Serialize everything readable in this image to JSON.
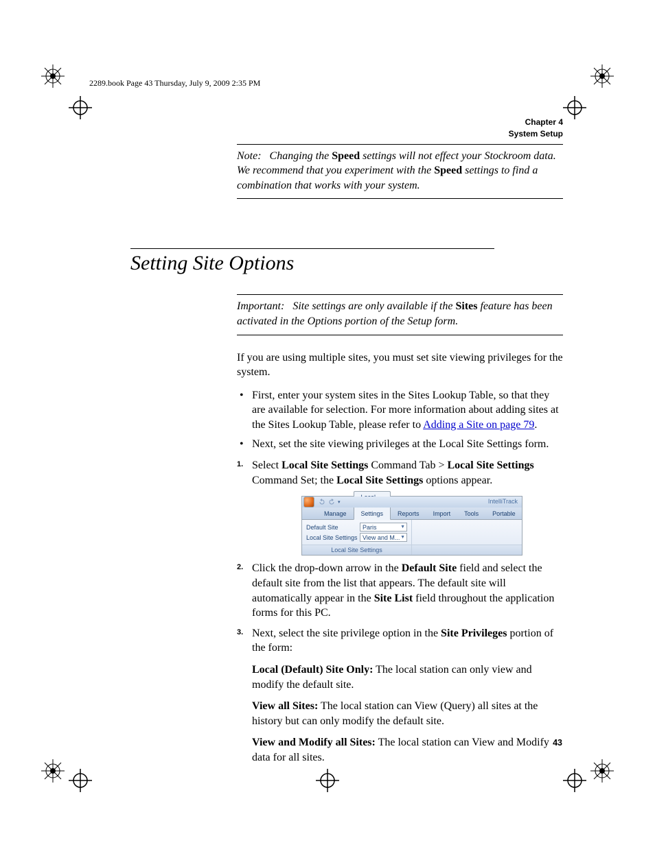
{
  "header_slug": "2289.book  Page 43  Thursday, July 9, 2009  2:35 PM",
  "running_head": {
    "line1": "Chapter 4",
    "line2": "System Setup"
  },
  "note": {
    "label": "Note:",
    "t1": "Changing the ",
    "b1": "Speed",
    "t2": " settings will not effect your Stockroom data. We recommend that you experiment with the ",
    "b2": "Speed",
    "t3": " settings to find a combination that works with your system."
  },
  "section_title": "Setting Site Options",
  "important": {
    "label": "Important:",
    "t1": "Site settings are only available if the ",
    "b1": "Sites",
    "t2": " feature has been activated in the Options portion of the Setup form."
  },
  "intro": "If you are using multiple sites, you must set site viewing privileges for the system.",
  "bullets": {
    "b1a": "First, enter your system sites in the Sites Lookup Table, so that they are available for selection. For more information about adding sites at the Sites Lookup Table, please refer to ",
    "b1link": "Adding a Site on page 79",
    "b1b": ".",
    "b2": "Next, set the site viewing privileges at the Local Site Settings form."
  },
  "steps": {
    "s1": {
      "num": "1.",
      "a": "Select ",
      "b1": "Local Site Settings",
      "b": " Command Tab > ",
      "b2": "Local Site Settings",
      "c": " Command Set; the ",
      "b3": "Local Site Settings",
      "d": " options appear."
    },
    "s2": {
      "num": "2.",
      "a": "Click the drop-down arrow in the ",
      "b1": "Default Site",
      "b": " field and select the default site from the list that appears. The default site will automatically appear in the ",
      "b2": "Site List",
      "c": " field throughout the application forms for this PC."
    },
    "s3": {
      "num": "3.",
      "a": "Next, select the site privilege option in the ",
      "b1": "Site Privileges",
      "b": " portion of the form:"
    }
  },
  "priv": {
    "p1l": "Local (Default) Site Only:",
    "p1t": " The local station can only view and modify the default site.",
    "p2l": "View all Sites:",
    "p2t": " The local station can View (Query) all sites at the history but can only modify the default site.",
    "p3l": "View and Modify all Sites:",
    "p3t": " The local station can View and Modify data for all sites."
  },
  "ribbon": {
    "app_title": "IntelliTrack",
    "tabs": [
      "Manage",
      "Local Site Settings",
      "Reports",
      "Import",
      "Tools",
      "Portable"
    ],
    "active_tab_index": 1,
    "fields": {
      "default_site_label": "Default Site",
      "default_site_value": "Paris",
      "lss_label": "Local Site Settings",
      "lss_value": "View and M..."
    },
    "group_name": "Local Site Settings"
  },
  "page_number": "43"
}
